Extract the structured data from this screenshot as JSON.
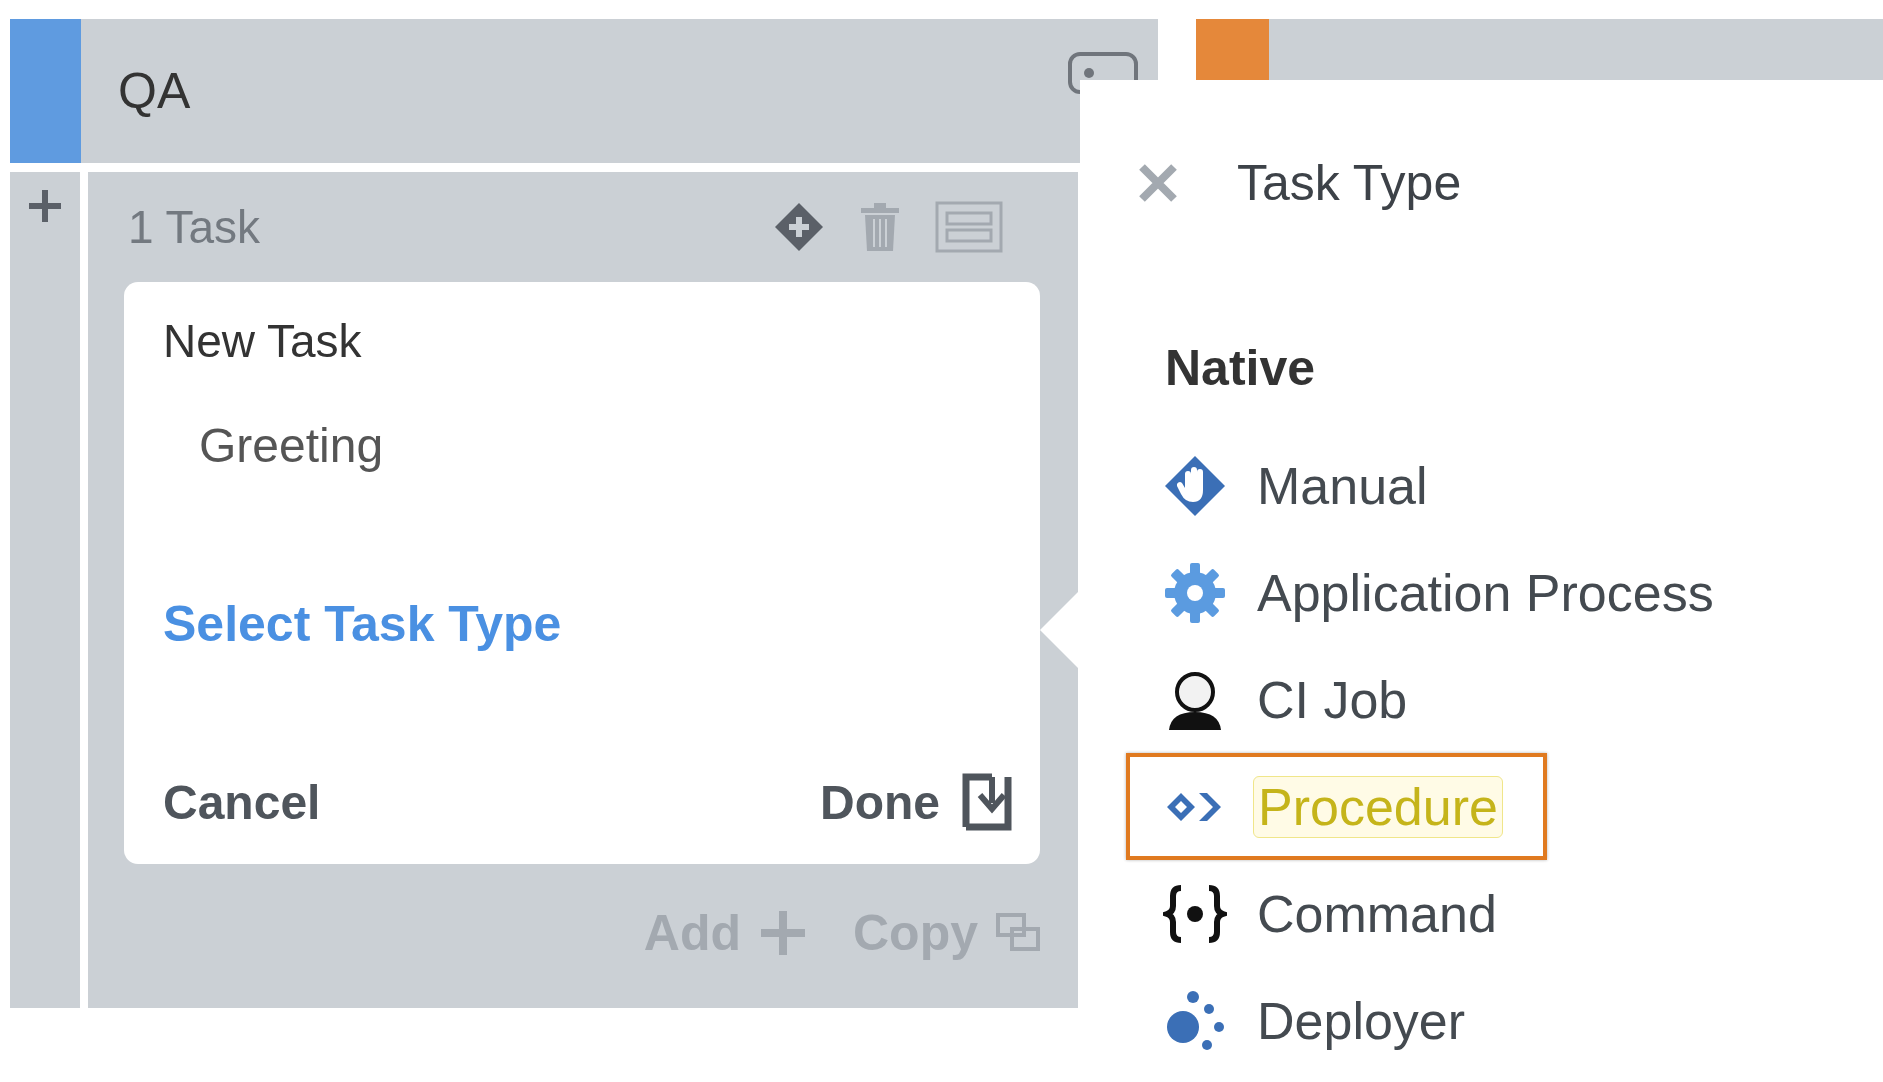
{
  "stages": [
    {
      "title": "QA",
      "color": "#5f9be0"
    },
    {
      "color": "#e5883a"
    }
  ],
  "task_group": {
    "count": "1 Task"
  },
  "new_task": {
    "title": "New Task",
    "name": "Greeting",
    "select_type": "Select Task Type",
    "cancel": "Cancel",
    "done": "Done"
  },
  "footer_actions": [
    {
      "label": "Add",
      "kind": "add",
      "disabled": true
    },
    {
      "label": "Copy",
      "kind": "copy",
      "disabled": true
    }
  ],
  "task_type_panel": {
    "title": "Task Type",
    "section": "Native",
    "items": [
      {
        "label": "Manual",
        "kind": "manual",
        "selected": false
      },
      {
        "label": "Application Process",
        "kind": "process",
        "selected": false
      },
      {
        "label": "CI Job",
        "kind": "ci",
        "selected": false
      },
      {
        "label": "Procedure",
        "kind": "procedure",
        "selected": true
      },
      {
        "label": "Command",
        "kind": "command",
        "selected": false
      },
      {
        "label": "Deployer",
        "kind": "deployer",
        "selected": false
      }
    ]
  }
}
